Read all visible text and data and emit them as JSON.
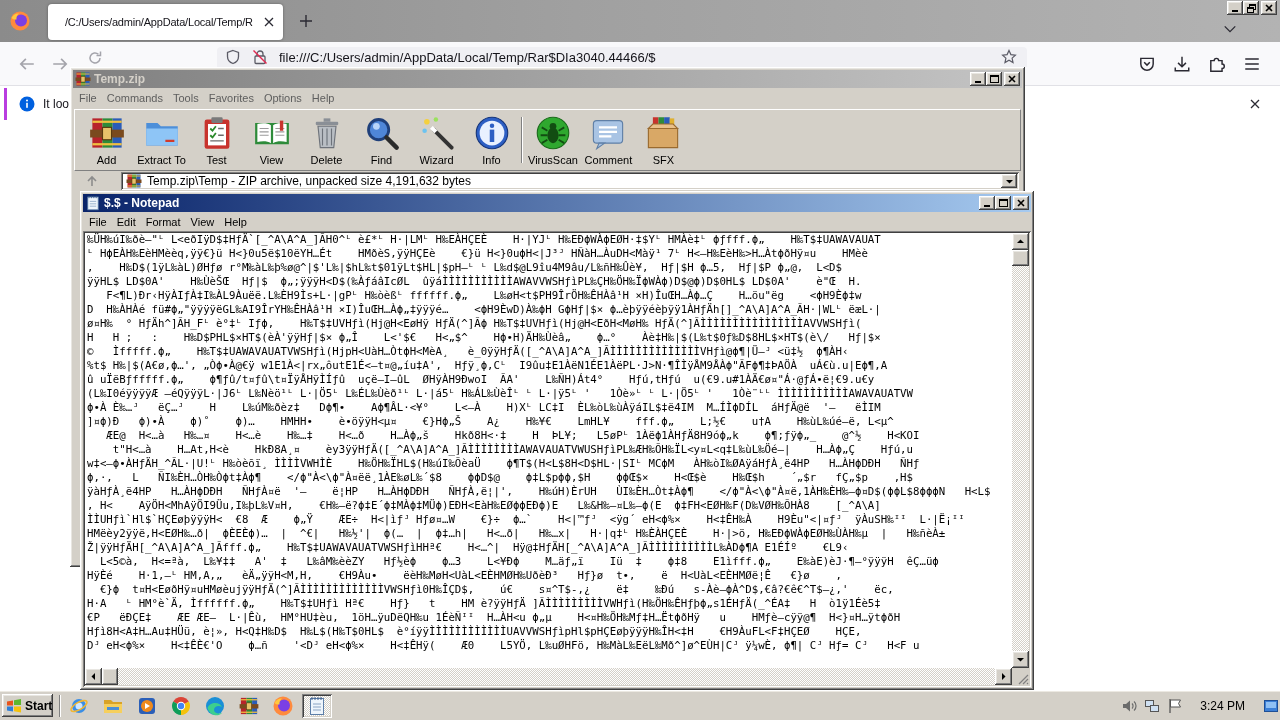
{
  "browser": {
    "tabs": [
      {
        "title": "/C:/Users/admin/AppData/Local/Temp/R",
        "selected": true
      }
    ],
    "address": "file:///C:/Users/admin/AppData/Local/Temp/Rar$DIa3040.44466/$",
    "notice": "It loo"
  },
  "archiver": {
    "title": "Temp.zip",
    "active": false,
    "menu": [
      "File",
      "Commands",
      "Tools",
      "Favorites",
      "Options",
      "Help"
    ],
    "toolbar": [
      {
        "kind": "add",
        "label": "Add"
      },
      {
        "kind": "extract",
        "label": "Extract To"
      },
      {
        "kind": "test",
        "label": "Test"
      },
      {
        "kind": "view",
        "label": "View"
      },
      {
        "kind": "delete",
        "label": "Delete"
      },
      {
        "kind": "find",
        "label": "Find"
      },
      {
        "kind": "wizard",
        "label": "Wizard"
      },
      {
        "kind": "info",
        "label": "Info"
      },
      {
        "kind": "separator"
      },
      {
        "kind": "virusscan",
        "label": "VirusScan"
      },
      {
        "kind": "comment",
        "label": "Comment"
      },
      {
        "kind": "sfx",
        "label": "SFX"
      }
    ],
    "path": "Temp.zip\\Temp - ZIP archive, unpacked size 4,191,632 bytes"
  },
  "notepad": {
    "title": "$.$ - Notepad",
    "active": true,
    "menu": [
      "File",
      "Edit",
      "Format",
      "View",
      "Help"
    ],
    "lines": [
      "‰ÜH‰úI‰ðè—\"ᴸ L<eðIÿD$‡HƒÄ`[_^A\\A^A_]ÃH0^ᴸ è£*ᴸ H·|LMᴸ H‰EÀHÇEÈ    H·|YJᴸ H‰EÐϕWÀϕEØH·‡$Yᴸ HMÀè‡ᴸ ϕƒfff.ϕ„    H‰T$‡UAWAVAUAT",
      "ᴸ HϕEÀH‰EèHMèèq,ÿÿ€}ü H<}0u5ë$10ëYH…Ét    HMðèS,ÿÿHÇEè    €}ü H<}0uϕH<|J³ᴶ HÑàH…ÀuDH<Màÿ¹ 7ᴸ H<–H‰EèH‰>H…ÀtϕðHÿ¤u    HMèè",
      ",    H‰D$(1ÿL‰àL)ØHƒø r°M‰àL‰þ%ø@^|$'L‰|$hL‰t$01ÿLt$HL|$pH–ᴸ ᴸ L‰d$@L9îu4M9âu/L‰ñH‰Ûè¥,  Hƒ|$H ϕ…5,  Hƒ|$P ϕ„@,  L<D$",
      "ÿÿHL$ LD$0A'    H‰ÙèŠŒ  Hƒ|$  ϕ„;ÿÿÿH<D$(‰ÀƒáâIcØL  ûÿáÌÌÌÌÌÌÌÌÌÌÌAWAVVWSHƒìPL‰ÇH‰ÖH‰ÏϕWÀϕ)D$@ϕ)D$0HL$ LD$0A'    è\"Œ  H.",
      "   F<¶L)Ðr‹HÿÀIƒÀ‡I‰ÀL9Àuëë.L‰ÈH9Ìs+L·|gPᴸ H‰òèßᴸ ffffff.ϕ„    L‰øH<t$PH9ÎrÖH‰ÊHÀâ¹H ×H)ÎuŒH…Àϕ…Ç    H…öu\"ëg    <ϕH9Èϕ‡w",
      "D  H‰ÀHÀé fü#ϕ„\"ÿÿÿÿëGL‰AI9ÎrYH‰ÊHÀâ¹H ×I)ÎuŒH…Àϕ„‡ÿÿÿé…    <ϕH9ÈwD)À‰ϕH GϕHƒ|$× ϕ…èþÿÿéèþÿÿ1ÀHƒÄh[]_^A\\A]A^A_ÃH·|WLᴸ ëæL·|",
      "ø¤H‰  ° HƒÄh^]ÃH_Fᴸ è°‡ᴸ Iƒϕ,    H‰T$‡UVHƒì(Hj@H<EøHÿ HƒÄ(^]Ãϕ H‰T$‡UVHƒì(Hj@H<EðH<MøH‰ HƒÄ(^]ÃÌÌÌÌÌÌÌÌÌÌÌÌÌÌÌÌAVVWSHƒì(",
      "H   H ;   :    H‰D$PHL$×HT$(èÀ'ÿÿHƒ|$× ϕ„Î    L<'$€   H<„$^    Hϕ•H)ÄH‰Ùèâ„    ϕ…°    Àè‡H‰|$(L‰t$0ƒ‰D$8HL$×HT$(è\\/   Hƒ|$×",
      "©   Ìfffff.ϕ„    H‰T$‡UAWAVAUATVWSHƒì(HjpH<UàH…ÒtϕH<MèA¸   è_0ÿÿHƒÄ([_^A\\A]A^A_]ÃÌÌÌÌÌÌÌÌÌÌÌÌÌÌVHƒì@ϕ¶|Ü–ᴶ <ü‡½  ϕ¶ÀH‹",
      "%t$ H‰|$(A€ø,ϕ…', „Òϕ•À@€ÿ w1E1À<|rx„ôutE1É<–t¤@„íu‡A',  Hƒÿ¸ϕ,Cᴸ  I9ûu‡E1ÀëN1ÉE1ÀëPL·J>N·¶ÎÌÿÅM9ÅÀϕ\"ÃFϕ¶‡ÞAÖÀ  uÁ€ù.u|Eϕ¶,A",
      "û uÏëBƒfffff.ϕ„    ϕ¶ƒû/t¤ƒû\\t¤ÏÿÅHÿÌÍƒû  uçë–I–ûL  ØHÿÀH9ÐwoI  ÃA'    L‰ÑH)Át4°    Hƒú,tHƒú  u(€9.u#1ÀÄ€ø¤\"Á·@ƒÁ•ë¦€9.u€y",
      "(L‰I0éÿÿÿÿÆ –éQÿÿÿL·|J6ᴸ L‰Nèö¹ᴸ L·|Ö5ᴸ L‰ÉL‰Ùèð¹ᴸ L·|á5ᴸ H‰ÁL‰ÙèÎᴸ ᴸ L·|ÿ5ᴸ '   1Òè»ᴸ ᴸ L·|Ö5ᴸ '   1Òè¨ᴸᴸ ÌÌÌÌÌÌÌÌÌÌÌAWAVAUATVW",
      "ϕ•À È‰…ᴶ   ëÇ…ᴶ    H    L‰úM‰ðèz‡   Dϕ¶•    Aϕ¶ÂL·<¥°    L<–À    H)Xᴸ LC‡I  ÈL‰òL‰ùÀÿáIL$‡ë4IM  M…ÍÌϕDÍL  áHƒÄ@ë  '–   ëÌIM",
      "]¤ϕ)Ð   ϕ)•À    ϕ)˚    ϕ)…    HMHH•    è•öÿÿH<µ¤    €}Hϕ„Š    A¿    H‰¥€    LmHL¥    fff.ϕ„    L;½€    u†A    H‰ùL‰úé–ë, L<µ^",
      "   ÆE@  H<…à   H‰…¤    H<…è    H‰…‡    H<…ð    H…Àϕ„š    Hkð8H<·‡    H  ÞL¥;   L5øPᴸ 1Àëϕ1ÀHƒÄ8H9óϕ„k    ϕ¶;ƒÿϕ„_    @^½    H<KOI",
      "    t\"H<…à    H…At‚H<è    HkÐ8A¸¤    èy3ÿÿHƒÄ([_^A\\A]A^A_]ÃÌÌÌÌÌÌÌÌAWAVAUATVWUSHƒìPL‰ÆH‰ÕH‰ÏL<y¤L<q‡L‰ùL‰Öé–|    H…Àϕ„Ç    Hƒú‚u",
      "w‡<–ϕ•ÀHƒÄH_^ÃL·|U!ᴸ H‰òèõï¸ ÌÌÌÌVWHÌÈ    H‰ÖH‰ÏHL$(H‰úI‰ÕèaÜ    ϕ¶T$(H<L$8H<D$HL·|SIᴸ MCϕM   ÀH‰òI‰ØAÿáHƒÀ¸ë4HP   H…ÀHϕDÐH   ÑHƒ",
      "ϕ,·,   L   ÑI‰ÈH…ÒH‰Òϕt‡Àϕ¶    </ϕ\"À<\\ϕ\"À¤ëë¸1ÀE‰øL‰´$8    ϕϕD$@    ϕ‡L$pϕϕ,$H    ϕϕŒ$×    H<Œ$è    H‰Œ$h    ´„$r   fÇ„$p    ,H$",
      "ÿàHƒÀ¸ë4HP   H…ÀHϕDÐH   ÑHƒÀ¤ë  '–    ë¦HP   H…ÀHϕDÐH   ÑHƒÀ‚ë¦|'‚    H‰úH)ÈrUH   ÙI‰ÈH…Òt‡Àϕ¶    </ϕ\"À<\\ϕ\"À¤ë‚1ÀH‰ÈH‰–ϕ¤D$(ϕϕL$8ϕϕϕN   H<L$",
      ", H<    AÿÖH<MhAÿÖI9Üu‚I‰þL‰V¤H‚    €H‰–ë?ϕ‡E´ϕ‡MÀϕ‡MÜϕ)EÐH<EàH‰EØϕϕEÐϕ)E   L‰&H‰–¤L‰–ϕ(E  ϕ‡FH<EØH‰F(D‰VØH‰ÕHÀ8    [_^A\\A]",
      "ÌÌUHƒì`Hl$`HÇEøþÿÿÿH<  €8  Æ    ϕ„Ÿ    ÆE÷  H<|ìƒᴶ Hƒø¤…W    €}÷  ϕ…`    H<|™ƒᴶ  <ÿg´ eH<ϕ%×    H<‡ÊH‰À    H9Èu\"<|¤ƒᴶ  ÿÀuSH‰ᴵᴵ  L·|Ë¡ᴵᴵ",
      "HMëèy2ÿÿë‚H<EØH‰…ð|  ϕÈEÈϕ)…  |  ^€|   H‰½'|  ϕ(…  |  ϕ‡…h|   H<…ð|   H‰…x|   H·|q‡ᴸ H‰ÈÀHÇEÈ    H·|>ö‚ H‰EÐϕWÀϕEØH‰ÙÀH‰µ  |   H‰ñèÀ±",
      "Ž|ÿÿHƒÄH[_^A\\A]A^A_]Ãfff.ϕ„    H‰T$‡UAWAVAUATVWSHƒìHHª€    H<…^|  Hÿ@‡HƒÄH[_^A\\A]A^A_]ÃÌÌÌÌÌÌÌÌÌÌL‰ÀDϕ¶A E1ÉÍº    €L9‹",
      "  L<5©à‚  H<=ªà‚  L‰¥‡‡   A'  ‡   L‰âM‰èèZY   Hƒ½èϕ    ϕ…3    L<¥Ðϕ    M…äƒ„ï    Iü  ‡    ϕ‡8    E1ìfff.ϕ„    E‰àE)èJ·¶–°ÿÿÿH  êÇ…üϕ",
      "HÿÈé    H·1‚–ᴸ HM‚A‚„   èÄ„ÿÿH<M‚H‚    €H9Àu•    ëèH‰MøH<UàL<EÈHMØH‰UðèÐ³   Hƒ}ø  t•‚    ë  H<UàL<EÈHMØë¦Ê   €}ø    ‚",
      "  €}ϕ  t¤H<EøðHÿ¤uHMøèujÿÿHƒÄ(^]ÃÌÌÌÌÌÌÌÌÌÌÌÌÌVWSHƒì0H‰ÎÇD$,    ú€    s¤^T$-‚¿    ë‡    ‰Ðú   s-Àè–ϕÀ^D$,€â?€ê€^T$–¿‚'    ëc‚",
      "H·A   ᴸ HM°è`Ä‚ Ìffffff.ϕ„    H‰T$‡UHƒì Hª€    Hƒ}   t    HM è?ÿÿHƒÄ ]ÃÌÌÌÌÌÌÌÌÌVWHƒì(H‰ÖH‰ÊHƒþϕ„s1ÉHƒÄ(_^ÉA‡   H  ò1ÿ1Éè5‡",
      "€P   ëÐÇE‡    ÆE ÆE–  L·|Êù‚  HM°HU‡èu‚  1öH…ÿuDëQH‰u 1ÉèÑᴵᴵ  H…ÀH<u ϕ„µ    H<¤H‰ÖH‰Mƒ‡H…ËtϕðHÿ   u    HMƒè–cÿÿ@¶  H<}¤H…ÿtϕðH",
      "Hƒì8H<A‡H…Au‡HÜü‚ è¦»‚ H<Q‡H‰D$  H‰L$(H‰T$0HL$  è°íÿÿÌÌÌÌÌÌÌÌÌÌÌÌUAVVWSHƒìpHl$pHÇEøþÿÿÿH‰ÎH<‡H    €H9ÀuFL<F‡HÇEØ    HÇE‚",
      "Dᴶ eH<ϕ%×    H<‡ÊÈ€'O    ϕ…ñ    '<Dᴶ eH<ϕ%×    H<‡ÊHÿ(    Æ0    L5YÖ‚ L‰uØHFö‚ H‰MàL‰EëL‰Mð^]ø^EÙH|Cᴶ ÿ¼wÈ‚ ϕ¶| Cᴶ Hƒ= Cᴶ   H<F u"
    ]
  },
  "taskbar": {
    "start": "Start",
    "apps": [
      {
        "kind": "ie",
        "selected": false
      },
      {
        "kind": "explorer",
        "selected": false
      },
      {
        "kind": "player",
        "selected": false
      },
      {
        "kind": "chrome",
        "selected": false
      },
      {
        "kind": "edge",
        "selected": false
      },
      {
        "kind": "winrar",
        "selected": false
      },
      {
        "kind": "firefox",
        "selected": false
      },
      {
        "kind": "notepad",
        "selected": true
      }
    ],
    "clock": "3:24 PM"
  }
}
